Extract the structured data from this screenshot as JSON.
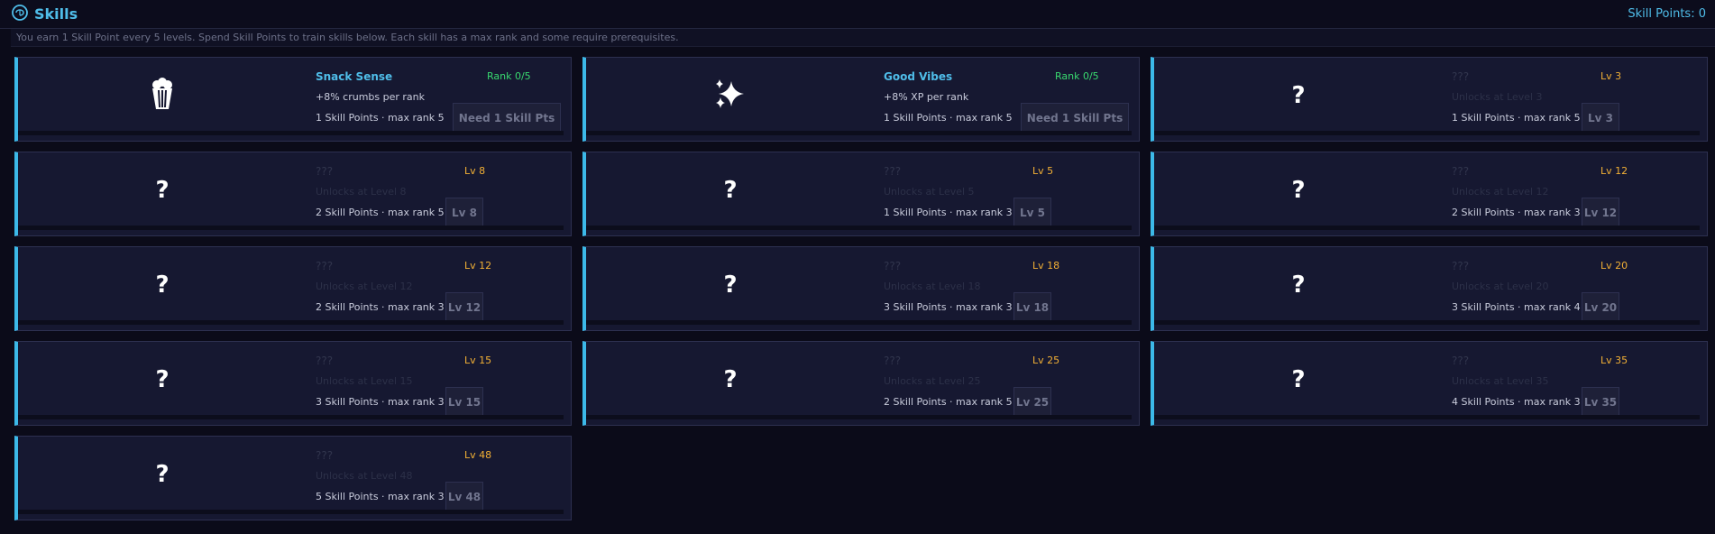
{
  "header": {
    "title": "Skills",
    "points_label": "Skill Points: 0",
    "accent": "#4fbde9"
  },
  "info": "You earn 1 Skill Point every 5 levels. Spend Skill Points to train skills below. Each skill has a max rank and some require prerequisites.",
  "cards": [
    {
      "icon": "popcorn-icon",
      "name": "Snack Sense",
      "desc": "+8% crumbs per rank",
      "cost": "1 Skill Points  ·  max rank 5",
      "tag": "Rank 0/5",
      "btn": "Need 1 Skill Pts",
      "locked": false
    },
    {
      "icon": "sparkles-icon",
      "name": "Good Vibes",
      "desc": "+8% XP per rank",
      "cost": "1 Skill Points  ·  max rank 5",
      "tag": "Rank 0/5",
      "btn": "Need 1 Skill Pts",
      "locked": false
    },
    {
      "icon": "question-icon",
      "q": "?",
      "name": "???",
      "desc": "Unlocks at Level 3",
      "cost": "1 Skill Points  ·  max rank 5",
      "tag": "Lv 3",
      "btn": "Lv 3",
      "locked": true
    },
    {
      "icon": "question-icon",
      "q": "?",
      "name": "???",
      "desc": "Unlocks at Level 8",
      "cost": "2 Skill Points  ·  max rank 5",
      "tag": "Lv 8",
      "btn": "Lv 8",
      "locked": true
    },
    {
      "icon": "question-icon",
      "q": "?",
      "name": "???",
      "desc": "Unlocks at Level 5",
      "cost": "1 Skill Points  ·  max rank 3",
      "tag": "Lv 5",
      "btn": "Lv 5",
      "locked": true
    },
    {
      "icon": "question-icon",
      "q": "?",
      "name": "???",
      "desc": "Unlocks at Level 12",
      "cost": "2 Skill Points  ·  max rank 3",
      "tag": "Lv 12",
      "btn": "Lv 12",
      "locked": true
    },
    {
      "icon": "question-icon",
      "q": "?",
      "name": "???",
      "desc": "Unlocks at Level 12",
      "cost": "2 Skill Points  ·  max rank 3",
      "tag": "Lv 12",
      "btn": "Lv 12",
      "locked": true
    },
    {
      "icon": "question-icon",
      "q": "?",
      "name": "???",
      "desc": "Unlocks at Level 18",
      "cost": "3 Skill Points  ·  max rank 3",
      "tag": "Lv 18",
      "btn": "Lv 18",
      "locked": true
    },
    {
      "icon": "question-icon",
      "q": "?",
      "name": "???",
      "desc": "Unlocks at Level 20",
      "cost": "3 Skill Points  ·  max rank 4",
      "tag": "Lv 20",
      "btn": "Lv 20",
      "locked": true
    },
    {
      "icon": "question-icon",
      "q": "?",
      "name": "???",
      "desc": "Unlocks at Level 15",
      "cost": "3 Skill Points  ·  max rank 3",
      "tag": "Lv 15",
      "btn": "Lv 15",
      "locked": true
    },
    {
      "icon": "question-icon",
      "q": "?",
      "name": "???",
      "desc": "Unlocks at Level 25",
      "cost": "2 Skill Points  ·  max rank 5",
      "tag": "Lv 25",
      "btn": "Lv 25",
      "locked": true
    },
    {
      "icon": "question-icon",
      "q": "?",
      "name": "???",
      "desc": "Unlocks at Level 35",
      "cost": "4 Skill Points  ·  max rank 3",
      "tag": "Lv 35",
      "btn": "Lv 35",
      "locked": true
    },
    {
      "icon": "question-icon",
      "q": "?",
      "name": "???",
      "desc": "Unlocks at Level 48",
      "cost": "5 Skill Points  ·  max rank 3",
      "tag": "Lv 48",
      "btn": "Lv 48",
      "locked": true
    }
  ]
}
